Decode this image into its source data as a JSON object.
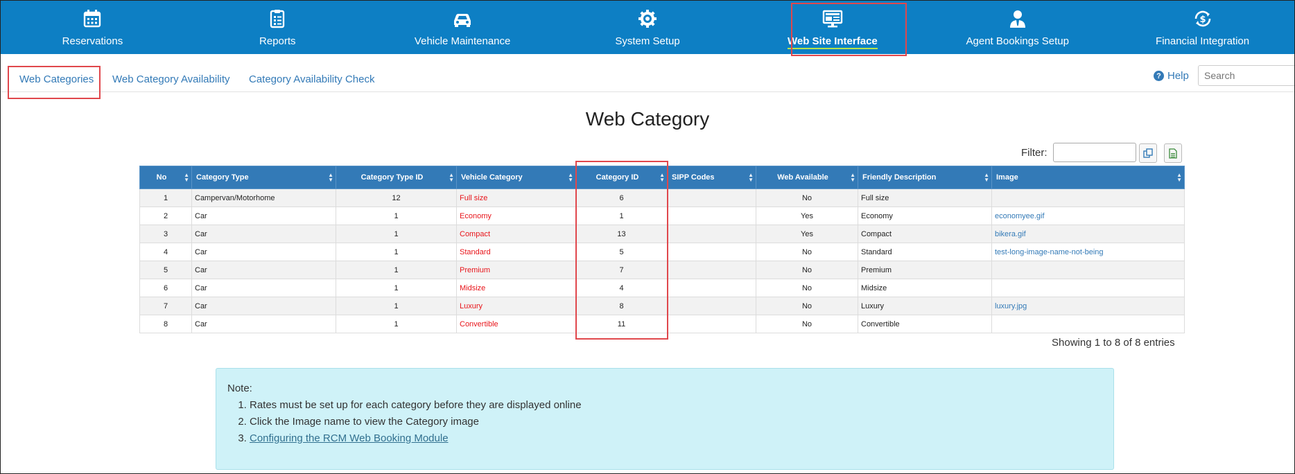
{
  "nav": {
    "items": [
      {
        "label": "Reservations",
        "icon": "calendar-icon"
      },
      {
        "label": "Reports",
        "icon": "clipboard-icon"
      },
      {
        "label": "Vehicle Maintenance",
        "icon": "car-icon"
      },
      {
        "label": "System Setup",
        "icon": "gear-icon"
      },
      {
        "label": "Web Site Interface",
        "icon": "monitor-icon",
        "active": true
      },
      {
        "label": "Agent Bookings Setup",
        "icon": "agent-icon"
      },
      {
        "label": "Financial Integration",
        "icon": "dollar-sync-icon"
      }
    ]
  },
  "subnav": {
    "tabs": [
      "Web Categories",
      "Web Category Availability",
      "Category Availability Check"
    ],
    "help": "Help",
    "search_placeholder": "Search"
  },
  "page": {
    "title": "Web Category"
  },
  "filter": {
    "label": "Filter:",
    "value": ""
  },
  "table": {
    "columns": [
      "No",
      "Category Type",
      "Category Type ID",
      "Vehicle Category",
      "Category ID",
      "SIPP Codes",
      "Web Available",
      "Friendly Description",
      "Image"
    ],
    "rows": [
      [
        "1",
        "Campervan/Motorhome",
        "12",
        "Full size",
        "6",
        "",
        "No",
        "Full size",
        ""
      ],
      [
        "2",
        "Car",
        "1",
        "Economy",
        "1",
        "",
        "Yes",
        "Economy",
        "economyee.gif"
      ],
      [
        "3",
        "Car",
        "1",
        "Compact",
        "13",
        "",
        "Yes",
        "Compact",
        "bikera.gif"
      ],
      [
        "4",
        "Car",
        "1",
        "Standard",
        "5",
        "",
        "No",
        "Standard",
        "test-long-image-name-not-being"
      ],
      [
        "5",
        "Car",
        "1",
        "Premium",
        "7",
        "",
        "No",
        "Premium",
        ""
      ],
      [
        "6",
        "Car",
        "1",
        "Midsize",
        "4",
        "",
        "No",
        "Midsize",
        ""
      ],
      [
        "7",
        "Car",
        "1",
        "Luxury",
        "8",
        "",
        "No",
        "Luxury",
        "luxury.jpg"
      ],
      [
        "8",
        "Car",
        "1",
        "Convertible",
        "11",
        "",
        "No",
        "Convertible",
        ""
      ]
    ],
    "showing": "Showing 1 to 8 of 8 entries"
  },
  "note": {
    "title": "Note:",
    "items": [
      "Rates must be set up for each category before they are displayed online",
      "Click the Image name to view the Category image"
    ],
    "link": "Configuring the RCM Web Booking Module"
  },
  "colors": {
    "nav_bg": "#0d7fc4",
    "header_bg": "#337ab7",
    "highlight": "#e0474c",
    "red_text": "#e8141a",
    "note_bg": "#cff2f8"
  }
}
